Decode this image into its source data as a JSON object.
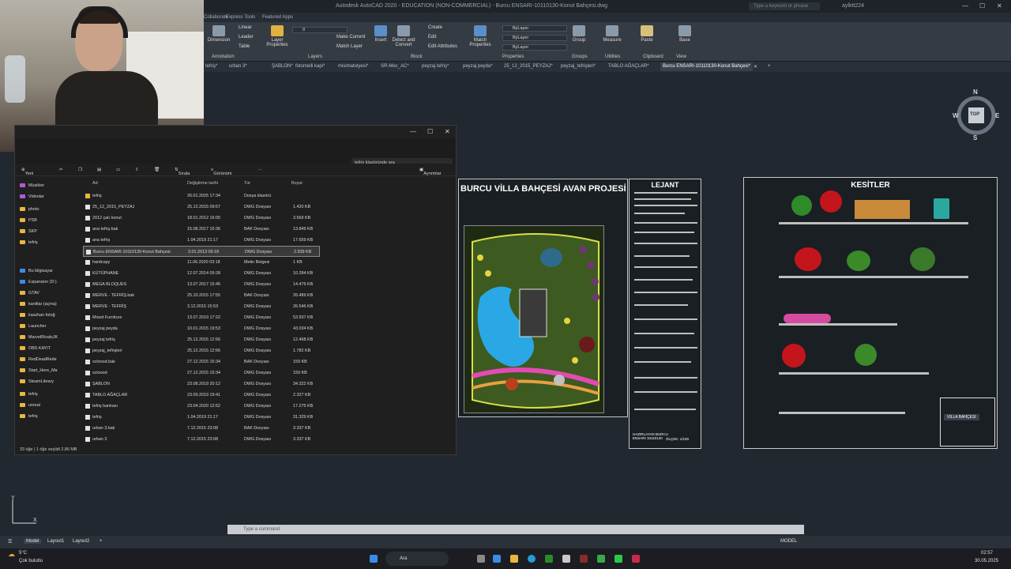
{
  "acad": {
    "title": "Autodesk AutoCAD 2020 - EDUCATION (NON-COMMERCIAL) - Burcu ENSARI-10110130-Konut Bahçesi.dwg",
    "search_placeholder": "Type a keyword or phrase",
    "user": "aylktt224",
    "ribbon_tabs": [
      "Collaborate",
      "Express Tools",
      "Featured Apps"
    ],
    "ribbon": {
      "dimension": "Dimension",
      "linear": "Linear",
      "leader": "Leader",
      "table": "Table",
      "annotation_group": "Annotation",
      "layer_properties": "Layer Properties",
      "make_current": "Make Current",
      "match_layer": "Match Layer",
      "layers_group": "Layers",
      "insert": "Insert",
      "detect_convert": "Detect and Convert",
      "create": "Create",
      "edit": "Edit",
      "edit_attributes": "Edit Attributes",
      "block_group": "Block",
      "match_properties": "Match Properties",
      "bylayer_1": "ByLayer",
      "bylayer_2": "ByLayer",
      "bylayer_3": "ByLayer",
      "properties_group": "Properties",
      "group": "Group",
      "groups_group": "Groups",
      "measure": "Measure",
      "utilities_group": "Utilities",
      "paste": "Paste",
      "clipboard_group": "Clipboard",
      "base": "Base",
      "view_group": "View"
    },
    "file_tabs": [
      "tefriş*",
      "urban 3*",
      "ŞABLON*",
      "fotomelli kapi*",
      "misimatolyesi*",
      "SR-Mec_AC*",
      "peyzaj tefriş*",
      "peyzaj peyda*",
      "25_12_2015_PEYZAJ*",
      "peyzaj_tefrişleri*",
      "TABLO AĞAÇLAR*",
      "Burcu ENSARI-10110130-Konut Bahçesi*"
    ],
    "viewcube": {
      "n": "N",
      "s": "S",
      "e": "E",
      "w": "W",
      "top": "TOP",
      "wcs": "WCS"
    },
    "command_placeholder": "Type a command",
    "layout_tabs": [
      "Model",
      "Layout1",
      "Layout2"
    ],
    "status_model": "MODEL"
  },
  "drawing": {
    "main_title": "BURCU VİLLA BAHÇESİ AVAN PROJESİ",
    "legend_title": "LEJANT",
    "sections_title": "KESİTLER",
    "titleblock_name": "VİLLA BAHÇESİ",
    "legend_footer": "HAZIRLAYAN BURCU ENSARI 10110130",
    "scale": "ÖLÇEK: 1/100"
  },
  "explorer": {
    "search_placeholder": "tefriş klasöründe ara",
    "commands": {
      "new": "Yeni",
      "sort": "Sırala",
      "view": "Görünüm",
      "details": "Ayrıntılar",
      "more": "···"
    },
    "columns": {
      "name": "Ad",
      "date": "Değiştirme tarihi",
      "type": "Tür",
      "size": "Boyut"
    },
    "nav": [
      {
        "label": "Müzikler",
        "kind": "purple"
      },
      {
        "label": "Videolar",
        "kind": "purple"
      },
      {
        "label": "photo",
        "kind": "folder"
      },
      {
        "label": "PSB",
        "kind": "folder"
      },
      {
        "label": "SKP",
        "kind": "folder"
      },
      {
        "label": "tefriş",
        "kind": "folder"
      },
      {
        "label": "Bu bilgisayar",
        "kind": "blue"
      },
      {
        "label": "Expansion (D:)",
        "kind": "blue"
      },
      {
        "label": "GTAV",
        "kind": "folder"
      },
      {
        "label": "kanitlar (açma)",
        "kind": "folder"
      },
      {
        "label": "kaszhan fotoğ",
        "kind": "folder"
      },
      {
        "label": "Launcher",
        "kind": "folder"
      },
      {
        "label": "MarvelRivalsJK",
        "kind": "folder"
      },
      {
        "label": "OBS KAYIT",
        "kind": "folder"
      },
      {
        "label": "RedDeadRede",
        "kind": "folder"
      },
      {
        "label": "Start_Here_Ma",
        "kind": "folder"
      },
      {
        "label": "SteamLibrary",
        "kind": "folder"
      },
      {
        "label": "tefriş",
        "kind": "folder"
      },
      {
        "label": "unreal",
        "kind": "folder"
      },
      {
        "label": "tefriş",
        "kind": "folder"
      }
    ],
    "files": [
      {
        "name": "tefriş",
        "date": "26.01.2025 17:34",
        "type": "Dosya klasörü",
        "size": "",
        "folder": true
      },
      {
        "name": "25_12_2015_PEYZAJ",
        "date": "25.12.2015 09:57",
        "type": "DWG Dosyası",
        "size": "1.420 KB"
      },
      {
        "name": "2012 çatı konut",
        "date": "18.01.2012 16:05",
        "type": "DWG Dosyası",
        "size": "3.569 KB"
      },
      {
        "name": "ana tefriş.bak",
        "date": "15.08.2017 15:36",
        "type": "BAK Dosyası",
        "size": "13.849 KB"
      },
      {
        "name": "ana tefriş",
        "date": "1.04.2019 21:17",
        "type": "DWG Dosyası",
        "size": "17.659 KB"
      },
      {
        "name": "Burcu ENSARI-10110130-Konut Bahçesi",
        "date": "3.01.2013 09:18",
        "type": "DWG Dosyası",
        "size": "2.939 KB",
        "selected": true
      },
      {
        "name": "hardcopy",
        "date": "11.06.2020 03:18",
        "type": "Metin Belgesi",
        "size": "1 KB"
      },
      {
        "name": "KÜTÜPHANE",
        "date": "12.07.2014 09:28",
        "type": "DWG Dosyası",
        "size": "10.284 KB"
      },
      {
        "name": "MEGA BLOQUES",
        "date": "13.07.2017 15:45",
        "type": "DWG Dosyası",
        "size": "14.479 KB"
      },
      {
        "name": "MERVE - TEFRİŞ.bak",
        "date": "25.10.2015 17:55",
        "type": "BAK Dosyası",
        "size": "26.489 KB"
      },
      {
        "name": "MERVE - TEFRİŞ",
        "date": "3.12.2015 15:53",
        "type": "DWG Dosyası",
        "size": "26.546 KB"
      },
      {
        "name": "Mixed Furniture",
        "date": "13.07.2019 17:22",
        "type": "DWG Dosyası",
        "size": "53.937 KB"
      },
      {
        "name": "peyzaj peyda",
        "date": "10.01.2015 19:53",
        "type": "DWG Dosyası",
        "size": "43.034 KB"
      },
      {
        "name": "peyzaj tefriş",
        "date": "25.12.2015 12:56",
        "type": "DWG Dosyası",
        "size": "12.468 KB"
      },
      {
        "name": "peyzaj_tefrişleri",
        "date": "25.12.2015 12:56",
        "type": "DWG Dosyası",
        "size": "1.782 KB"
      },
      {
        "name": "scloood.bak",
        "date": "27.12.2015 15:34",
        "type": "BAK Dosyası",
        "size": "159 KB"
      },
      {
        "name": "scloood",
        "date": "27.12.2015 15:34",
        "type": "DWG Dosyası",
        "size": "159 KB"
      },
      {
        "name": "ŞABLON",
        "date": "23.08.2019 20:12",
        "type": "DWG Dosyası",
        "size": "34.322 KB"
      },
      {
        "name": "TABLO AĞAÇLAR",
        "date": "23.09.2019 19:41",
        "type": "DWG Dosyası",
        "size": "2.327 KB"
      },
      {
        "name": "tefriş bankası",
        "date": "23.04.2020 12:52",
        "type": "DWG Dosyası",
        "size": "17.275 KB"
      },
      {
        "name": "tefriş",
        "date": "1.04.2019 21:17",
        "type": "DWG Dosyası",
        "size": "31.329 KB"
      },
      {
        "name": "urban 3.bak",
        "date": "7.12.2015 23:08",
        "type": "BAK Dosyası",
        "size": "3.337 KB"
      },
      {
        "name": "urban 3",
        "date": "7.12.2015 23:08",
        "type": "DWG Dosyası",
        "size": "3.337 KB"
      }
    ],
    "status": "33 öğe  |  1 öğe seçildi 2,86 MB"
  },
  "taskbar": {
    "weather_temp": "5°C",
    "weather_desc": "Çok bulutlu",
    "search": "Ara",
    "time": "02:57",
    "date": "30.05.2025"
  }
}
